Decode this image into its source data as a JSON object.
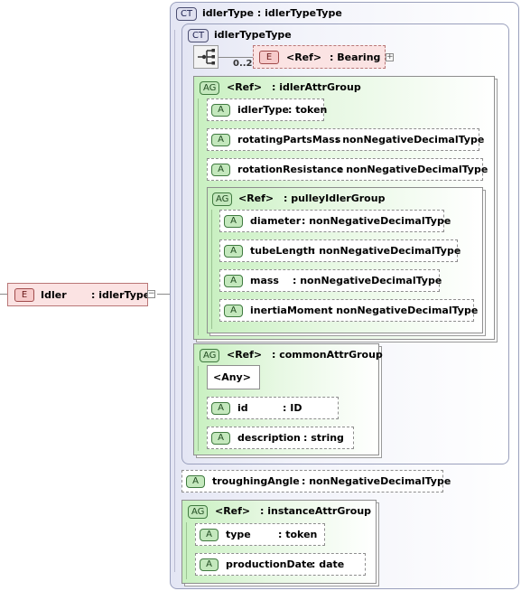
{
  "root_element": {
    "badge": "E",
    "name": "Idler",
    "type": ": idlerType",
    "toggle": "−"
  },
  "complex_type": {
    "badge": "CT",
    "name": "idlerType",
    "type": ": idlerTypeType"
  },
  "inner_type": {
    "badge": "CT",
    "name": "idlerTypeType"
  },
  "sequence": {
    "icon": "sequence-icon",
    "occurrence": "0..2"
  },
  "bearing_ref": {
    "badge": "E",
    "ref": "<Ref>",
    "type": ": Bearing",
    "toggle": "+"
  },
  "idler_attr_group": {
    "badge": "AG",
    "ref": "<Ref>",
    "name": ": idlerAttrGroup",
    "attributes": [
      {
        "badge": "A",
        "name": "idlerType",
        "type": ": token"
      },
      {
        "badge": "A",
        "name": "rotatingPartsMass",
        "type": ": nonNegativeDecimalType"
      },
      {
        "badge": "A",
        "name": "rotationResistance",
        "type": ": nonNegativeDecimalType"
      }
    ]
  },
  "pulley_idler_group": {
    "badge": "AG",
    "ref": "<Ref>",
    "name": ": pulleyIdlerGroup",
    "attributes": [
      {
        "badge": "A",
        "name": "diameter",
        "type": ": nonNegativeDecimalType"
      },
      {
        "badge": "A",
        "name": "tubeLength",
        "type": ": nonNegativeDecimalType"
      },
      {
        "badge": "A",
        "name": "mass",
        "type": ": nonNegativeDecimalType"
      },
      {
        "badge": "A",
        "name": "inertiaMoment",
        "type": ": nonNegativeDecimalType"
      }
    ]
  },
  "common_attr_group": {
    "badge": "AG",
    "ref": "<Ref>",
    "name": ": commonAttrGroup",
    "any_label": "<Any>",
    "attributes": [
      {
        "badge": "A",
        "name": "id",
        "type": ": ID"
      },
      {
        "badge": "A",
        "name": "description",
        "type": ": string"
      }
    ]
  },
  "troughing_angle": {
    "badge": "A",
    "name": "troughingAngle",
    "type": ": nonNegativeDecimalType"
  },
  "instance_attr_group": {
    "badge": "AG",
    "ref": "<Ref>",
    "name": ": instanceAttrGroup",
    "attributes": [
      {
        "badge": "A",
        "name": "type",
        "type": ": token"
      },
      {
        "badge": "A",
        "name": "productionDate",
        "type": ": date"
      }
    ]
  }
}
